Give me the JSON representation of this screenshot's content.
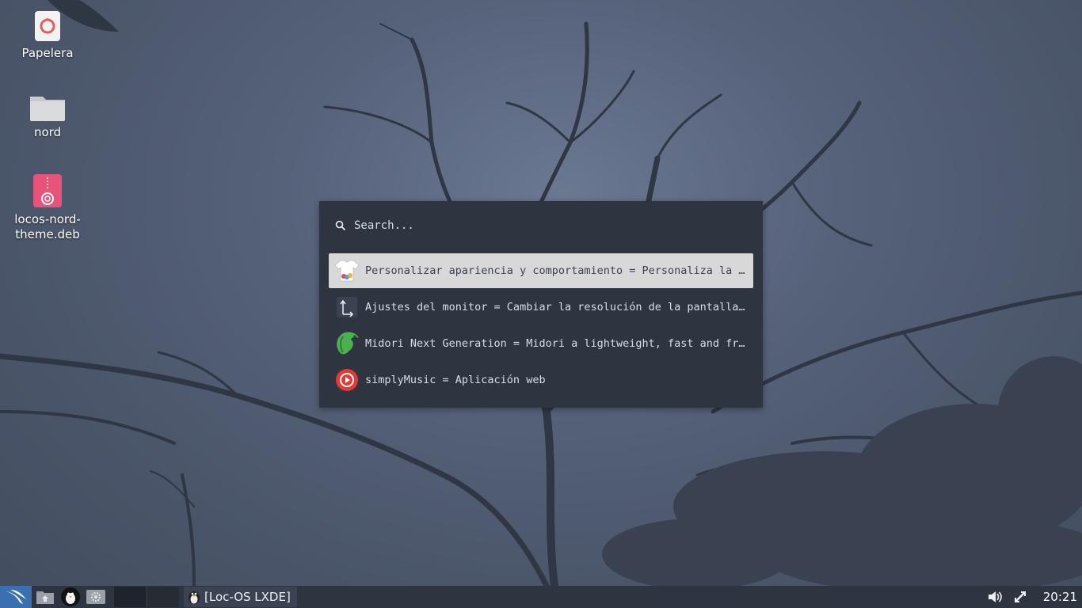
{
  "desktop": {
    "icons": [
      {
        "label": "Papelera",
        "icon": "trash-icon"
      },
      {
        "label": "nord",
        "icon": "folder-icon"
      },
      {
        "label": "locos-nord-theme.deb",
        "label_line1": "locos-nord-",
        "label_line2": "theme.deb",
        "icon": "package-icon"
      }
    ]
  },
  "launcher": {
    "search_placeholder": "Search...",
    "results": [
      {
        "text": "Personalizar apariencia y comportamiento =  Personaliza la apariencia del escritorio",
        "icon": "appearance-icon",
        "selected": true
      },
      {
        "text": "Ajustes del monitor =  Cambiar la resolución de la pantalla y la posición de los monitores",
        "icon": "monitor-settings-icon",
        "selected": false
      },
      {
        "text": "Midori Next Generation =  Midori a lightweight, fast and free web browser",
        "icon": "midori-icon",
        "selected": false
      },
      {
        "text": "simplyMusic =  Aplicación web",
        "icon": "music-play-icon",
        "selected": false
      }
    ]
  },
  "taskbar": {
    "task_label": "[Loc-OS LXDE]",
    "clock": "20:21"
  },
  "colors": {
    "panel": "#2e3440",
    "launcher_bg": "#2e3440",
    "selection": "#d8d8d8",
    "start_button": "#3a6fb0"
  }
}
